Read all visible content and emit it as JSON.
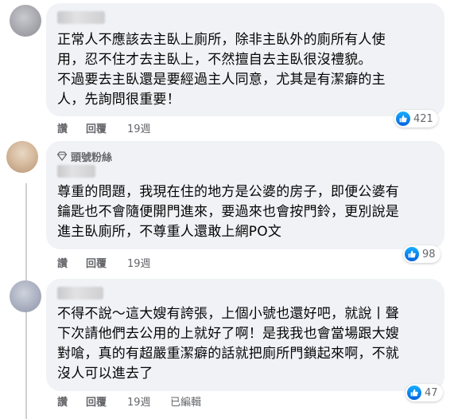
{
  "comments": [
    {
      "badge": "",
      "lines": [
        "正常人不應該去主臥上廁所，除非主臥外的廁所有人使",
        "用，忍不住才去主臥上，不然擅自去主臥很沒禮貌。",
        "不過要去主臥還是要經過主人同意，尤其是有潔癖的主",
        "人，先詢問很重要！"
      ],
      "actions": {
        "like": "讚",
        "reply": "回覆",
        "time": "19週",
        "edited": ""
      },
      "reaction_count": "421"
    },
    {
      "badge": "頭號粉絲",
      "lines": [
        "尊重的問題，我現在住的地方是公婆的房子，即便公婆有",
        "鑰匙也不會隨便開門進來，要過來也會按門鈴，更別說是",
        "進主臥廁所，不尊重人還敢上網PO文"
      ],
      "actions": {
        "like": "讚",
        "reply": "回覆",
        "time": "19週",
        "edited": ""
      },
      "reaction_count": "98"
    },
    {
      "badge": "",
      "lines": [
        "不得不說～這大嫂有誇張，上個小號也還好吧，就說丨聲",
        "下次請他們去公用的上就好了啊！是我我也會當場跟大嫂",
        "對嗆，真的有超嚴重潔癖的話就把廁所門鎖起來啊，不就",
        "沒人可以進去了"
      ],
      "actions": {
        "like": "讚",
        "reply": "回覆",
        "time": "19週",
        "edited": "已編輯"
      },
      "reaction_count": "47"
    }
  ],
  "icons": {
    "like": "like-icon",
    "badge": "diamond-icon"
  },
  "colors": {
    "bubble": "#f0f2f5",
    "meta_text": "#65676b",
    "like_blue": "#1877f2"
  }
}
